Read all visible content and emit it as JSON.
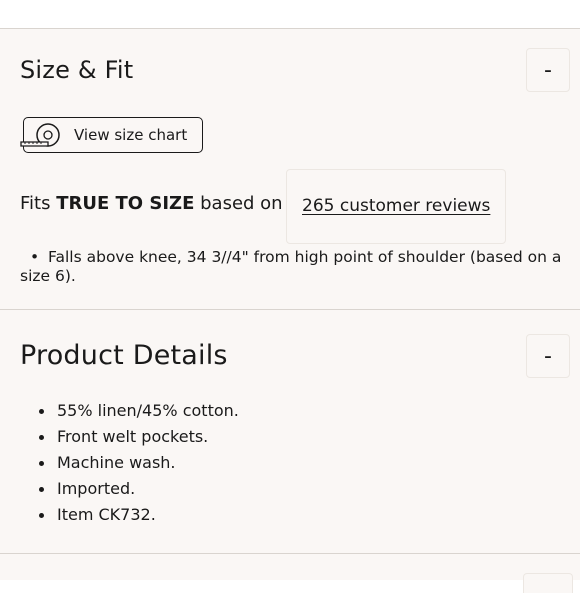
{
  "size_fit": {
    "title": "Size & Fit",
    "toggle_label": "-",
    "size_chart_label": "View size chart",
    "fits_prefix": "Fits ",
    "fits_emphasis": "TRUE TO SIZE",
    "fits_suffix": " based on",
    "reviews_link": "265 customer reviews",
    "fit_note": "Falls above knee, 34 3//4\" from high point of shoulder (based on a size 6)."
  },
  "product_details": {
    "title": "Product Details",
    "toggle_label": "-",
    "items": [
      "55% linen/45% cotton.",
      "Front welt pockets.",
      "Machine wash.",
      "Imported.",
      "Item CK732."
    ]
  },
  "icons": {
    "size_chart": "measuring-tape-icon"
  },
  "colors": {
    "section_background": "#faf7f5",
    "divider": "#d9d4cf",
    "text": "#1a1a1a"
  }
}
